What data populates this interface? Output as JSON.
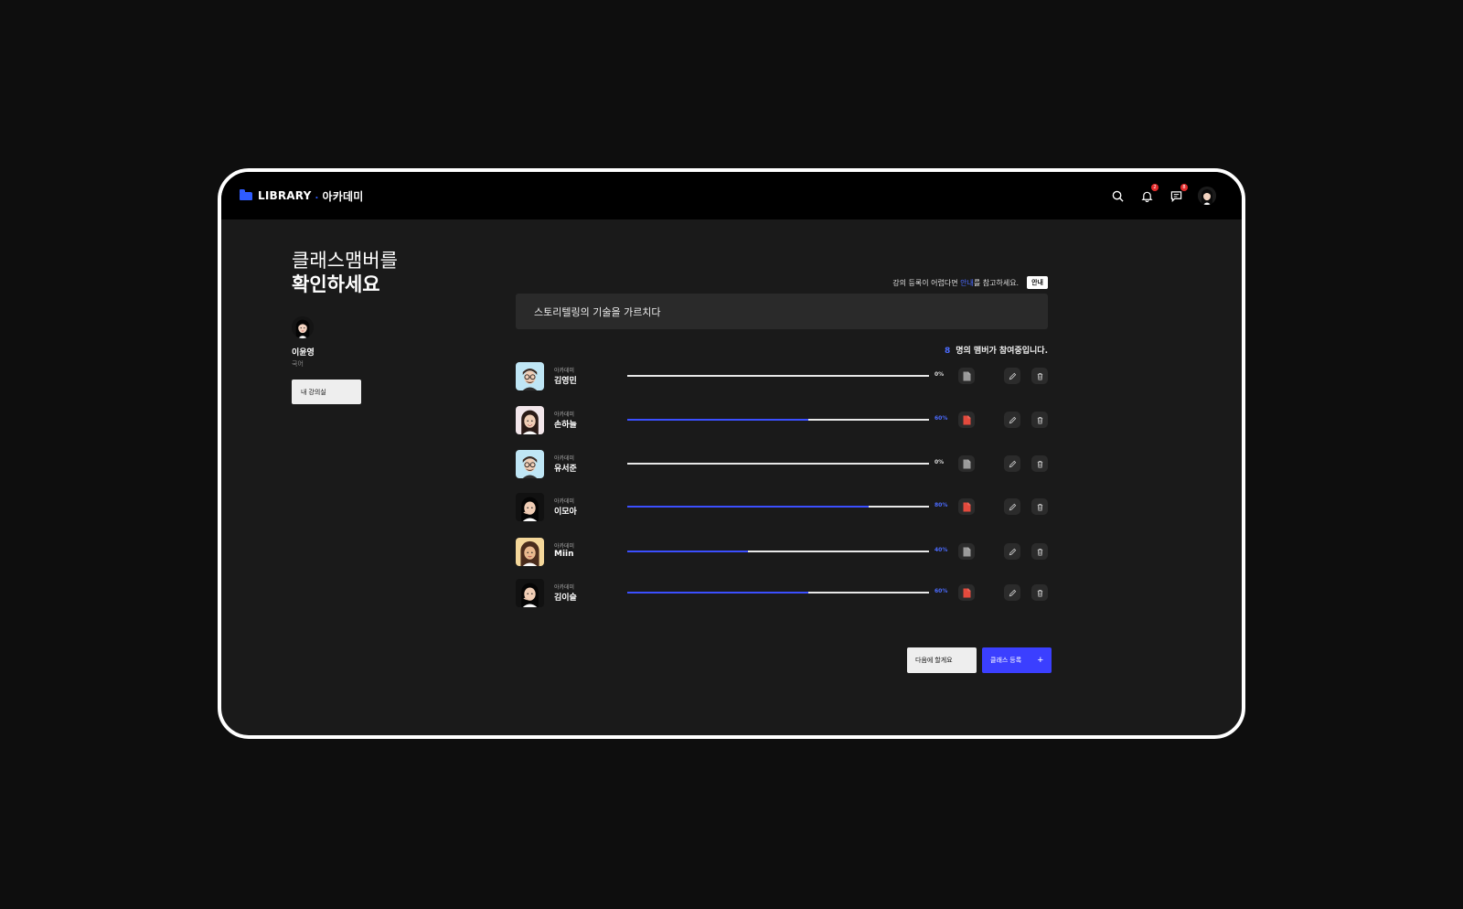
{
  "header": {
    "brand": "LIBRARY",
    "brand_sub": "아카데미",
    "notification_count": "2",
    "message_count": "8"
  },
  "left": {
    "title_line1": "클래스맴버를",
    "title_line2": "확인하세요",
    "user_name": "이윤영",
    "user_subject": "국어",
    "my_class_button": "내 강의실"
  },
  "main": {
    "hint_prefix": "강의 등록이 어렵다면",
    "hint_link": "안내",
    "hint_suffix": "를 참고하세요.",
    "hint_button": "안내",
    "class_title": "스토리텔링의 기술을 가르치다",
    "member_count": "8",
    "member_count_text": "명의 맴버가 참여중입니다."
  },
  "members": [
    {
      "org": "아카데미",
      "name": "김영민",
      "pct_label": "0%",
      "progress": 0,
      "file_status": "none",
      "avatar": "glasses-man",
      "bg": "#bfe6f5"
    },
    {
      "org": "아카데미",
      "name": "손하늘",
      "pct_label": "60%",
      "progress": 60,
      "file_status": "submitted",
      "avatar": "woman-long-hair",
      "bg": "#f2e6ea"
    },
    {
      "org": "아카데미",
      "name": "유서준",
      "pct_label": "0%",
      "progress": 0,
      "file_status": "none",
      "avatar": "glasses-man",
      "bg": "#bfe6f5"
    },
    {
      "org": "아카데미",
      "name": "이모아",
      "pct_label": "80%",
      "progress": 80,
      "file_status": "submitted",
      "avatar": "woman-bangs",
      "bg": "#111111"
    },
    {
      "org": "아카데미",
      "name": "Miin",
      "pct_label": "40%",
      "progress": 40,
      "file_status": "none",
      "avatar": "woman-curly",
      "bg": "#f4d79a"
    },
    {
      "org": "아카데미",
      "name": "김이슬",
      "pct_label": "60%",
      "progress": 60,
      "file_status": "submitted",
      "avatar": "woman-bangs",
      "bg": "#111111"
    }
  ],
  "footer": {
    "later_button": "다음에 할게요",
    "register_button": "클래스 등록",
    "register_plus": "+"
  },
  "colors": {
    "accent": "#3b4fff",
    "file_submitted": "#e34a3d",
    "file_none": "#9a9a9a"
  }
}
